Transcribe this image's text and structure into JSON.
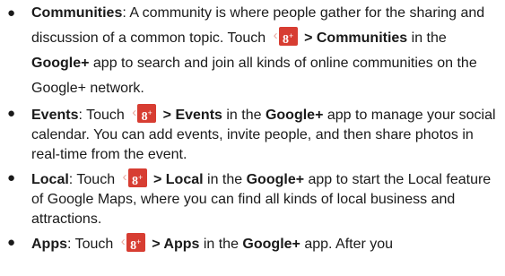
{
  "bullet_char": "●",
  "gplus_icon": {
    "letter": "8",
    "plus": "+",
    "chevron": "‹",
    "color": "#d73d32"
  },
  "items": [
    {
      "term": "Communities",
      "lead": ": A community is where people gather for the sharing and discussion of a common topic. Touch ",
      "arrow": " > ",
      "target": "Communities",
      "mid": " in the ",
      "app": "Google+",
      "tail": " app to search and join all kinds of online communities on the Google+ network."
    },
    {
      "term": "Events",
      "lead": ": Touch ",
      "arrow": " > ",
      "target": "Events",
      "mid": " in the ",
      "app": "Google+",
      "tail": " app to manage your social calendar. You can add events, invite people, and then share photos in real-time from the event."
    },
    {
      "term": "Local",
      "lead": ": Touch ",
      "arrow": " > ",
      "target": "Local",
      "mid": " in the ",
      "app": "Google+",
      "tail": " app to start the Local feature of Google Maps, where you can find all kinds of local business and attractions."
    },
    {
      "term": "Apps",
      "lead": ": Touch ",
      "arrow": " > ",
      "target": "Apps",
      "mid": " in the ",
      "app": "Google+",
      "tail": " app. After you"
    }
  ]
}
